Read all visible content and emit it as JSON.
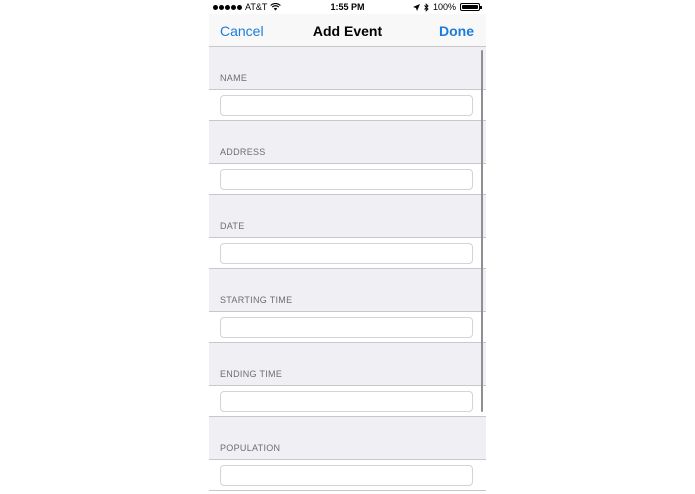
{
  "status_bar": {
    "carrier": "AT&T",
    "time": "1:55 PM",
    "battery": "100%",
    "battery_level": 1.0
  },
  "nav": {
    "cancel": "Cancel",
    "title": "Add Event",
    "done": "Done"
  },
  "form": {
    "fields": [
      {
        "label": "NAME",
        "value": ""
      },
      {
        "label": "ADDRESS",
        "value": ""
      },
      {
        "label": "DATE",
        "value": ""
      },
      {
        "label": "STARTING TIME",
        "value": ""
      },
      {
        "label": "ENDING TIME",
        "value": ""
      },
      {
        "label": "POPULATION",
        "value": ""
      }
    ]
  },
  "colors": {
    "accent": "#1a7ddc",
    "group_background": "#efeff4",
    "separator": "#c8c7cc",
    "section_label": "#6d6d72"
  }
}
